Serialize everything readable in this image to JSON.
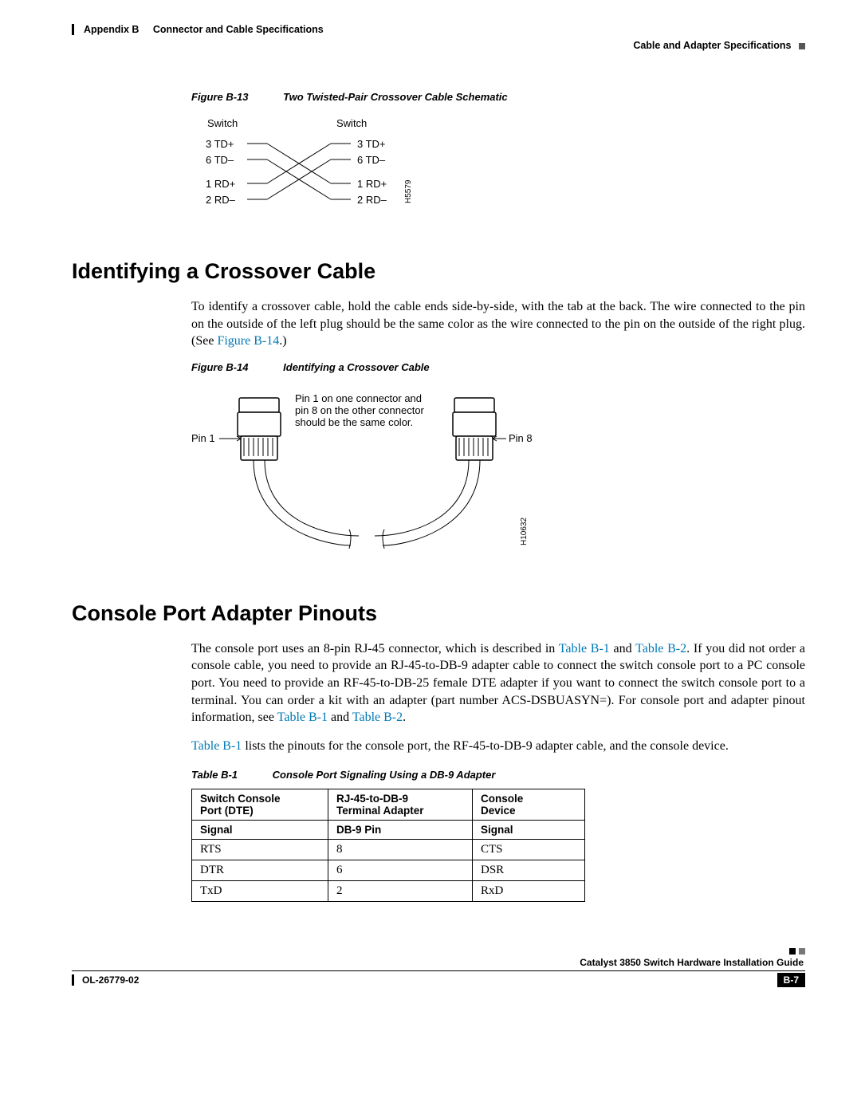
{
  "header": {
    "appendix": "Appendix B",
    "title": "Connector and Cable Specifications",
    "subsection": "Cable and Adapter Specifications"
  },
  "figures": {
    "b13": {
      "label": "Figure B-13",
      "title": "Two Twisted-Pair Crossover Cable Schematic"
    },
    "b14": {
      "label": "Figure B-14",
      "title": "Identifying a Crossover Cable"
    }
  },
  "fig_b13": {
    "left_label": "Switch",
    "right_label": "Switch",
    "left_pins": [
      "3 TD+",
      "6 TD–",
      "1 RD+",
      "2 RD–"
    ],
    "right_pins": [
      "3 TD+",
      "6 TD–",
      "1 RD+",
      "2 RD–"
    ],
    "drawing_id": "H5579"
  },
  "fig_b14": {
    "note_line1": "Pin 1 on one connector and",
    "note_line2": "pin 8 on the other connector",
    "note_line3": "should be the same color.",
    "left_label": "Pin 1",
    "right_label": "Pin 8",
    "drawing_id": "H10632"
  },
  "sections": {
    "s1": "Identifying a Crossover Cable",
    "s2": "Console Port Adapter Pinouts"
  },
  "paragraphs": {
    "p1a": "To identify a crossover cable, hold the cable ends side-by-side, with the tab at the back. The wire connected to the pin on the outside of the left plug should be the same color as the wire connected to the pin on the outside of the right plug. (See ",
    "p1b": ".)",
    "xref_b14": "Figure B-14",
    "p2a": "The console port uses an 8-pin RJ-45 connector, which is described in ",
    "p2b": " and ",
    "p2c": ". If you did not order a console cable, you need to provide an RJ-45-to-DB-9 adapter cable to connect the switch console port to a PC console port. You need to provide an RF-45-to-DB-25 female DTE adapter if you want to connect the switch console port to a terminal. You can order a kit with an adapter (part number ACS-DSBUASYN=). For console port and adapter pinout information, see ",
    "p2d": " and ",
    "p2e": ".",
    "xref_tb1": "Table B-1",
    "xref_tb2": "Table B-2",
    "p3a": " lists the pinouts for the console port, the RF-45-to-DB-9 adapter cable, and the console device."
  },
  "table_b1": {
    "label": "Table B-1",
    "title": "Console Port Signaling Using a DB-9 Adapter",
    "headers": {
      "a1": "Switch Console",
      "a2": "Port (DTE)",
      "b1": "RJ-45-to-DB-9",
      "b2": "Terminal Adapter",
      "c1": "Console",
      "c2": "Device",
      "sa": "Signal",
      "sb": "DB-9 Pin",
      "sc": "Signal"
    },
    "rows": [
      {
        "a": "RTS",
        "b": "8",
        "c": "CTS"
      },
      {
        "a": "DTR",
        "b": "6",
        "c": "DSR"
      },
      {
        "a": "TxD",
        "b": "2",
        "c": "RxD"
      }
    ]
  },
  "footer": {
    "guide": "Catalyst 3850 Switch Hardware Installation Guide",
    "docnum": "OL-26779-02",
    "pagenum": "B-7"
  }
}
